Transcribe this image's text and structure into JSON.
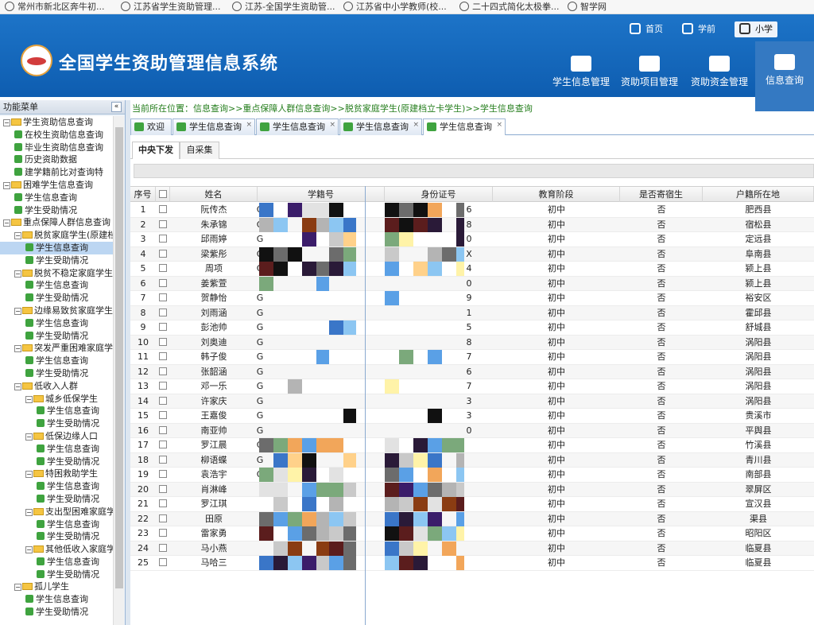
{
  "bookmarks": [
    {
      "label": "常州市新北区奔牛初..."
    },
    {
      "label": "江苏省学生资助管理..."
    },
    {
      "label": "江苏-全国学生资助管..."
    },
    {
      "label": "江苏省中小学教师(校..."
    },
    {
      "label": "二十四式简化太极拳..."
    },
    {
      "label": "智学网"
    }
  ],
  "header": {
    "title": "全国学生资助管理信息系统",
    "top_links": [
      "首页",
      "学前",
      "小学"
    ],
    "nav": [
      "学生信息管理",
      "资助项目管理",
      "资助资金管理",
      "信息查询"
    ]
  },
  "sidebar": {
    "title": "功能菜单",
    "collapse": "«",
    "tree": [
      {
        "label": "学生资助信息查询",
        "level": 0,
        "type": "folder",
        "ex": "⊟"
      },
      {
        "label": "在校生资助信息查询",
        "level": 1,
        "type": "leaf"
      },
      {
        "label": "毕业生资助信息查询",
        "level": 1,
        "type": "leaf"
      },
      {
        "label": "历史资助数据",
        "level": 1,
        "type": "leaf"
      },
      {
        "label": "建学籍前比对查询特",
        "level": 1,
        "type": "leaf"
      },
      {
        "label": "困难学生信息查询",
        "level": 0,
        "type": "folder",
        "ex": "⊟"
      },
      {
        "label": "学生信息查询",
        "level": 1,
        "type": "leaf"
      },
      {
        "label": "学生受助情况",
        "level": 1,
        "type": "leaf"
      },
      {
        "label": "重点保障人群信息查询",
        "level": 0,
        "type": "folder",
        "ex": "⊟"
      },
      {
        "label": "脱贫家庭学生(原建档",
        "level": 1,
        "type": "folder",
        "ex": "⊟"
      },
      {
        "label": "学生信息查询",
        "level": 2,
        "type": "leaf",
        "selected": true
      },
      {
        "label": "学生受助情况",
        "level": 2,
        "type": "leaf"
      },
      {
        "label": "脱贫不稳定家庭学生",
        "level": 1,
        "type": "folder",
        "ex": "⊟"
      },
      {
        "label": "学生信息查询",
        "level": 2,
        "type": "leaf"
      },
      {
        "label": "学生受助情况",
        "level": 2,
        "type": "leaf"
      },
      {
        "label": "边缘易致贫家庭学生",
        "level": 1,
        "type": "folder",
        "ex": "⊟"
      },
      {
        "label": "学生信息查询",
        "level": 2,
        "type": "leaf"
      },
      {
        "label": "学生受助情况",
        "level": 2,
        "type": "leaf"
      },
      {
        "label": "突发严重困难家庭学",
        "level": 1,
        "type": "folder",
        "ex": "⊟"
      },
      {
        "label": "学生信息查询",
        "level": 2,
        "type": "leaf"
      },
      {
        "label": "学生受助情况",
        "level": 2,
        "type": "leaf"
      },
      {
        "label": "低收入人群",
        "level": 1,
        "type": "folder",
        "ex": "⊟"
      },
      {
        "label": "城乡低保学生",
        "level": 2,
        "type": "folder",
        "ex": "⊟"
      },
      {
        "label": "学生信息查询",
        "level": 3,
        "type": "leaf"
      },
      {
        "label": "学生受助情况",
        "level": 3,
        "type": "leaf"
      },
      {
        "label": "低保边缘人口",
        "level": 2,
        "type": "folder",
        "ex": "⊟"
      },
      {
        "label": "学生信息查询",
        "level": 3,
        "type": "leaf"
      },
      {
        "label": "学生受助情况",
        "level": 3,
        "type": "leaf"
      },
      {
        "label": "特困救助学生",
        "level": 2,
        "type": "folder",
        "ex": "⊟"
      },
      {
        "label": "学生信息查询",
        "level": 3,
        "type": "leaf"
      },
      {
        "label": "学生受助情况",
        "level": 3,
        "type": "leaf"
      },
      {
        "label": "支出型困难家庭学",
        "level": 2,
        "type": "folder",
        "ex": "⊟"
      },
      {
        "label": "学生信息查询",
        "level": 3,
        "type": "leaf"
      },
      {
        "label": "学生受助情况",
        "level": 3,
        "type": "leaf"
      },
      {
        "label": "其他低收入家庭学",
        "level": 2,
        "type": "folder",
        "ex": "⊟"
      },
      {
        "label": "学生信息查询",
        "level": 3,
        "type": "leaf"
      },
      {
        "label": "学生受助情况",
        "level": 3,
        "type": "leaf"
      },
      {
        "label": "孤儿学生",
        "level": 1,
        "type": "folder",
        "ex": "⊟"
      },
      {
        "label": "学生信息查询",
        "level": 2,
        "type": "leaf"
      },
      {
        "label": "学生受助情况",
        "level": 2,
        "type": "leaf"
      }
    ]
  },
  "breadcrumb": "当前所在位置：信息查询>>重点保障人群信息查询>>脱贫家庭学生(原建档立卡学生)>>学生信息查询",
  "tabs": [
    "欢迎",
    "学生信息查询",
    "学生信息查询",
    "学生信息查询",
    "学生信息查询"
  ],
  "tab_close": "×",
  "subtabs": [
    "中央下发",
    "自采集"
  ],
  "table": {
    "columns": [
      "序号",
      "",
      "姓名",
      "学籍号",
      "身份证号",
      "教育阶段",
      "是否寄宿生",
      "户籍所在地"
    ],
    "rows": [
      {
        "n": "1",
        "name": "阮传杰",
        "xj": "G",
        "id": "6",
        "stage": "初中",
        "board": "否",
        "place": "肥西县"
      },
      {
        "n": "2",
        "name": "朱承锦",
        "xj": "G",
        "id": "8",
        "stage": "初中",
        "board": "否",
        "place": "宿松县"
      },
      {
        "n": "3",
        "name": "邱雨婷",
        "xj": "G",
        "id": "0",
        "stage": "初中",
        "board": "否",
        "place": "定远县"
      },
      {
        "n": "4",
        "name": "梁紫彤",
        "xj": "G",
        "id": "X",
        "stage": "初中",
        "board": "否",
        "place": "阜南县"
      },
      {
        "n": "5",
        "name": "周项",
        "xj": "G",
        "id": "4",
        "stage": "初中",
        "board": "否",
        "place": "颍上县"
      },
      {
        "n": "6",
        "name": "姜紫萱",
        "xj": "",
        "id": "0",
        "stage": "初中",
        "board": "否",
        "place": "颍上县"
      },
      {
        "n": "7",
        "name": "贺静怡",
        "xj": "G",
        "id": "9",
        "stage": "初中",
        "board": "否",
        "place": "裕安区"
      },
      {
        "n": "8",
        "name": "刘雨涵",
        "xj": "G",
        "id": "1",
        "stage": "初中",
        "board": "否",
        "place": "霍邱县"
      },
      {
        "n": "9",
        "name": "彭池帅",
        "xj": "G",
        "id": "5",
        "stage": "初中",
        "board": "否",
        "place": "舒城县"
      },
      {
        "n": "10",
        "name": "刘奥迪",
        "xj": "G",
        "id": "8",
        "stage": "初中",
        "board": "否",
        "place": "涡阳县"
      },
      {
        "n": "11",
        "name": "韩子俊",
        "xj": "G",
        "id": "7",
        "stage": "初中",
        "board": "否",
        "place": "涡阳县"
      },
      {
        "n": "12",
        "name": "张韶涵",
        "xj": "G",
        "id": "6",
        "stage": "初中",
        "board": "否",
        "place": "涡阳县"
      },
      {
        "n": "13",
        "name": "邓一乐",
        "xj": "G",
        "id": "7",
        "stage": "初中",
        "board": "否",
        "place": "涡阳县"
      },
      {
        "n": "14",
        "name": "许家庆",
        "xj": "G",
        "id": "3",
        "stage": "初中",
        "board": "否",
        "place": "涡阳县"
      },
      {
        "n": "15",
        "name": "王嘉俊",
        "xj": "G",
        "id": "3",
        "stage": "初中",
        "board": "否",
        "place": "贵溪市"
      },
      {
        "n": "16",
        "name": "南亚帅",
        "xj": "G",
        "id": "0",
        "stage": "初中",
        "board": "否",
        "place": "平舆县"
      },
      {
        "n": "17",
        "name": "罗江晨",
        "xj": "G",
        "id": "",
        "stage": "初中",
        "board": "否",
        "place": "竹溪县"
      },
      {
        "n": "18",
        "name": "柳语蝶",
        "xj": "G",
        "id": "",
        "stage": "初中",
        "board": "否",
        "place": "青川县"
      },
      {
        "n": "19",
        "name": "袁浩宇",
        "xj": "G",
        "id": "",
        "stage": "初中",
        "board": "否",
        "place": "南部县"
      },
      {
        "n": "20",
        "name": "肖淋峰",
        "xj": "",
        "id": "",
        "stage": "初中",
        "board": "否",
        "place": "翠屏区"
      },
      {
        "n": "21",
        "name": "罗江琪",
        "xj": "",
        "id": "",
        "stage": "初中",
        "board": "否",
        "place": "宣汉县"
      },
      {
        "n": "22",
        "name": "田原",
        "xj": "",
        "id": "",
        "stage": "初中",
        "board": "否",
        "place": "渠县"
      },
      {
        "n": "23",
        "name": "雷家勇",
        "xj": "",
        "id": "",
        "stage": "初中",
        "board": "否",
        "place": "昭阳区"
      },
      {
        "n": "24",
        "name": "马小燕",
        "xj": "",
        "id": "",
        "stage": "初中",
        "board": "否",
        "place": "临夏县"
      },
      {
        "n": "25",
        "name": "马哈三",
        "xj": "",
        "id": "",
        "stage": "初中",
        "board": "否",
        "place": "临夏县"
      }
    ]
  },
  "colors": {
    "banner": "#1565c0",
    "breadcrumb": "#257e1d",
    "tree_leaf": "#3fa33f",
    "tree_folder": "#f5c542",
    "selected_row": "#bcd6f2"
  }
}
